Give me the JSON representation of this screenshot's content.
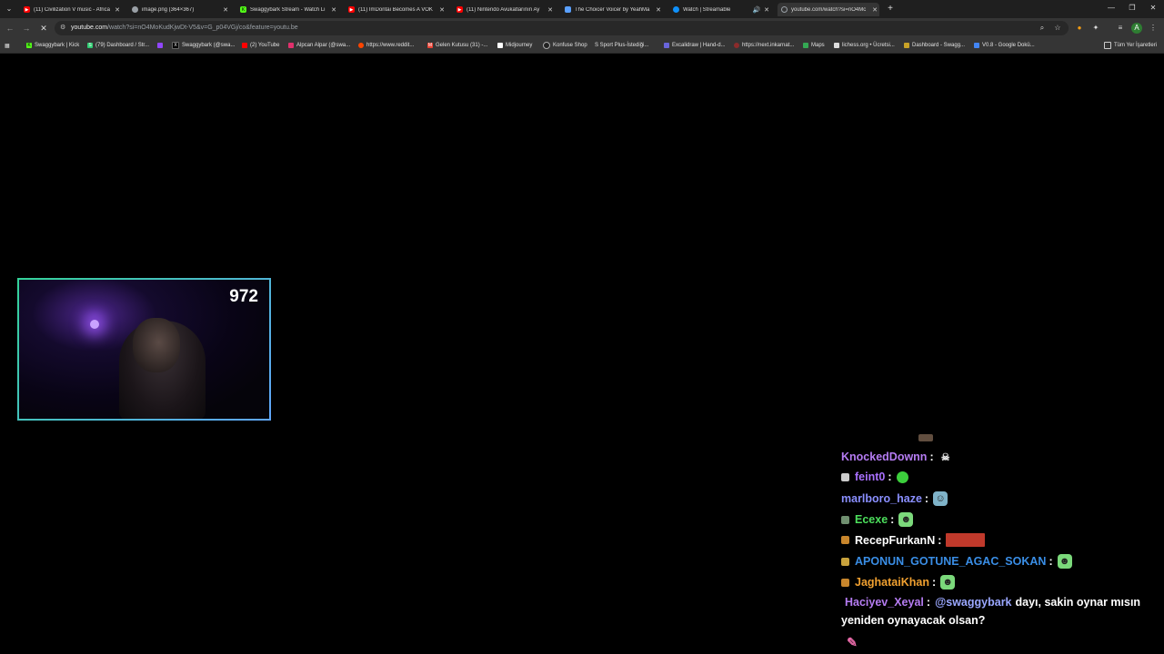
{
  "tabs": [
    {
      "title": "(11) Civilization V music - Africa",
      "icon_color": "#ff0000",
      "active": false
    },
    {
      "title": "image.png (364×367)",
      "icon_color": "#9aa0a6",
      "active": false
    },
    {
      "title": "Swaggybark Stream - Watch Li",
      "icon_color": "#53fc18",
      "active": false
    },
    {
      "title": "(11) ImDontai Becomes A VOK",
      "icon_color": "#ff0000",
      "active": false
    },
    {
      "title": "(11) Nintendo Avukatlarının Ay",
      "icon_color": "#ff0000",
      "active": false
    },
    {
      "title": "The Choicer Voicer by YeahMa",
      "icon_color": "#5aa0ff",
      "active": false
    },
    {
      "title": "Watch | Streamable",
      "icon_color": "#0f90fa",
      "active": false
    },
    {
      "title": "youtube.com/watch?si=nO4Mc",
      "icon_color": "#9aa0a6",
      "active": true
    }
  ],
  "toolbar": {
    "url_host": "youtube.com",
    "url_rest": "/watch?si=nO4MoKudKjwDt-V5&v=G_p04VGj/co&feature=youtu.be"
  },
  "bookmarks": [
    {
      "label": "Swaggybark | Kick",
      "icon_color": "#53fc18",
      "glyph": "K"
    },
    {
      "label": "(79) Dashboard / Str...",
      "icon_color": "#2ecc71",
      "glyph": "S"
    },
    {
      "label": "",
      "icon_color": "#9146ff",
      "glyph": ""
    },
    {
      "label": "Swaggybark (@swa...",
      "icon_color": "#000000",
      "glyph": "X"
    },
    {
      "label": "(2) YouTube",
      "icon_color": "#ff0000",
      "glyph": ""
    },
    {
      "label": "Alpcan Alpar (@swa...",
      "icon_color": "#e1306c",
      "glyph": ""
    },
    {
      "label": "https://www.reddit...",
      "icon_color": "#ff4500",
      "glyph": ""
    },
    {
      "label": "Gelen Kutusu (31) -...",
      "icon_color": "#ea4335",
      "glyph": "M"
    },
    {
      "label": "Midjourney",
      "icon_color": "#ffffff",
      "glyph": ""
    },
    {
      "label": "Konfuse Shop",
      "icon_color": "#222222",
      "glyph": ""
    },
    {
      "label": "S Sport Plus-İstediği...",
      "icon_color": "#222222",
      "glyph": ""
    },
    {
      "label": "Excalidraw | Hand-d...",
      "icon_color": "#6965db",
      "glyph": ""
    },
    {
      "label": "https://next.inkarnat...",
      "icon_color": "#8b2b2b",
      "glyph": ""
    },
    {
      "label": "Maps",
      "icon_color": "#34a853",
      "glyph": ""
    },
    {
      "label": "lichess.org • Ücretsi...",
      "icon_color": "#dddddd",
      "glyph": ""
    },
    {
      "label": "Dashboard - Swagg...",
      "icon_color": "#c9a227",
      "glyph": ""
    },
    {
      "label": "V0.8 - Google Dokü...",
      "icon_color": "#4285f4",
      "glyph": ""
    }
  ],
  "all_bookmarks_label": "Tüm Yer İşaretleri",
  "stream": {
    "viewer_count": "972"
  },
  "chat": [
    {
      "user": "KnockedDownn",
      "user_color": "#b57cf2",
      "badge_color": "",
      "emote_color": "#e8e8e8",
      "emote_glyph": "☠",
      "text": ""
    },
    {
      "user": "feint0",
      "user_color": "#a970ff",
      "badge_color": "#cccccc",
      "emote_color": "#3ccf3c",
      "emote_glyph": "●",
      "text": ""
    },
    {
      "user": "marlboro_haze",
      "user_color": "#8a8fff",
      "badge_color": "",
      "emote_color": "#7fb3c9",
      "emote_glyph": "☺",
      "text": ""
    },
    {
      "user": "Ecexe",
      "user_color": "#4cdf5c",
      "badge_color": "#6f8f6f",
      "emote_color": "#7bd97b",
      "emote_glyph": "☻",
      "text": ""
    },
    {
      "user": "RecepFurkanN",
      "user_color": "#ffffff",
      "badge_color": "#c8862c",
      "emote_color": "#c0392b",
      "emote_glyph": "",
      "text": ""
    },
    {
      "user": "APONUN_GOTUNE_AGAC_SOKAN",
      "user_color": "#3a8ee6",
      "badge_color": "#c8a23c",
      "emote_color": "#7bd97b",
      "emote_glyph": "☻",
      "text": ""
    },
    {
      "user": "JaghataiKhan",
      "user_color": "#f0a030",
      "badge_color": "#c8862c",
      "emote_color": "#7bd97b",
      "emote_glyph": "☻",
      "text": ""
    },
    {
      "user": "Haciyev_Xeyal",
      "user_color": "#b57cf2",
      "badge_color": "",
      "mention": "@swaggybark",
      "text": "dayı, sakin oynar mısın",
      "text2": "yeniden oynayacak olsan?"
    }
  ]
}
